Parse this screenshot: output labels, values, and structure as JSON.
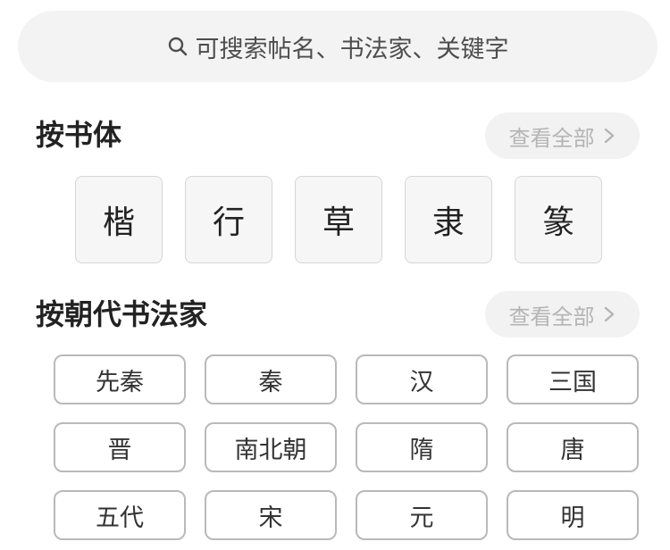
{
  "search": {
    "icon": "search-icon",
    "placeholder": "可搜索帖名、书法家、关键字"
  },
  "by_script": {
    "title": "按书体",
    "view_all": "查看全部",
    "items": [
      "楷",
      "行",
      "草",
      "隶",
      "篆"
    ]
  },
  "by_dynasty": {
    "title": "按朝代书法家",
    "view_all": "查看全部",
    "items": [
      "先秦",
      "秦",
      "汉",
      "三国",
      "晋",
      "南北朝",
      "隋",
      "唐",
      "五代",
      "宋",
      "元",
      "明"
    ]
  },
  "colors": {
    "search_bg": "#f3f3f3",
    "tile_bg": "#f6f6f6",
    "muted_text": "#b4b4b4",
    "border": "#b9b9b9"
  }
}
